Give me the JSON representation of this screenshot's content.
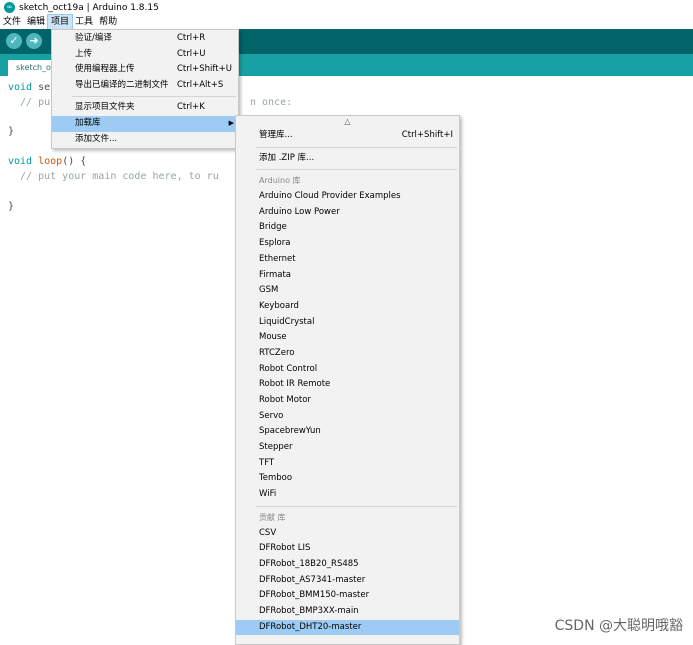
{
  "window": {
    "title": "sketch_oct19a | Arduino 1.8.15"
  },
  "menubar": {
    "items": [
      "文件",
      "编辑",
      "项目",
      "工具",
      "帮助"
    ]
  },
  "toolbar": {
    "verify_icon": "check-icon",
    "upload_icon": "arrow-right-icon"
  },
  "tab": {
    "label": "sketch_oct19a"
  },
  "editor": {
    "line1_kw": "void",
    "line1_rest": " se",
    "line2": "  // pu",
    "line2_tail": "n once:",
    "line3": "}",
    "line5_kw": "void",
    "line5_fn": "loop",
    "line5_rest": "() {",
    "line6": "  // put your main code here, to ru",
    "line8": "}"
  },
  "project_menu": {
    "items": [
      {
        "label": "验证/编译",
        "shortcut": "Ctrl+R"
      },
      {
        "label": "上传",
        "shortcut": "Ctrl+U"
      },
      {
        "label": "使用编程器上传",
        "shortcut": "Ctrl+Shift+U"
      },
      {
        "label": "导出已编译的二进制文件",
        "shortcut": "Ctrl+Alt+S"
      },
      {
        "label": "显示项目文件夹",
        "shortcut": "Ctrl+K"
      },
      {
        "label": "加载库",
        "shortcut": ""
      },
      {
        "label": "添加文件...",
        "shortcut": ""
      }
    ]
  },
  "library_menu": {
    "scroll_up": "△",
    "manage": {
      "label": "管理库...",
      "shortcut": "Ctrl+Shift+I"
    },
    "add_zip": "添加 .ZIP 库...",
    "arduino_header": "Arduino 库",
    "arduino_libs": [
      "Arduino Cloud Provider Examples",
      "Arduino Low Power",
      "Bridge",
      "Esplora",
      "Ethernet",
      "Firmata",
      "GSM",
      "Keyboard",
      "LiquidCrystal",
      "Mouse",
      "RTCZero",
      "Robot Control",
      "Robot IR Remote",
      "Robot Motor",
      "Servo",
      "SpacebrewYun",
      "Stepper",
      "TFT",
      "Temboo",
      "WiFi"
    ],
    "contrib_header": "贡献 库",
    "contrib_libs": [
      "CSV",
      "DFRobot LIS",
      "DFRobot_18B20_RS485",
      "DFRobot_AS7341-master",
      "DFRobot_BMM150-master",
      "DFRobot_BMP3XX-main",
      "DFRobot_DHT20-master"
    ],
    "selected": "DFRobot_DHT20-master"
  },
  "watermark": "CSDN @大聪明哦豁"
}
